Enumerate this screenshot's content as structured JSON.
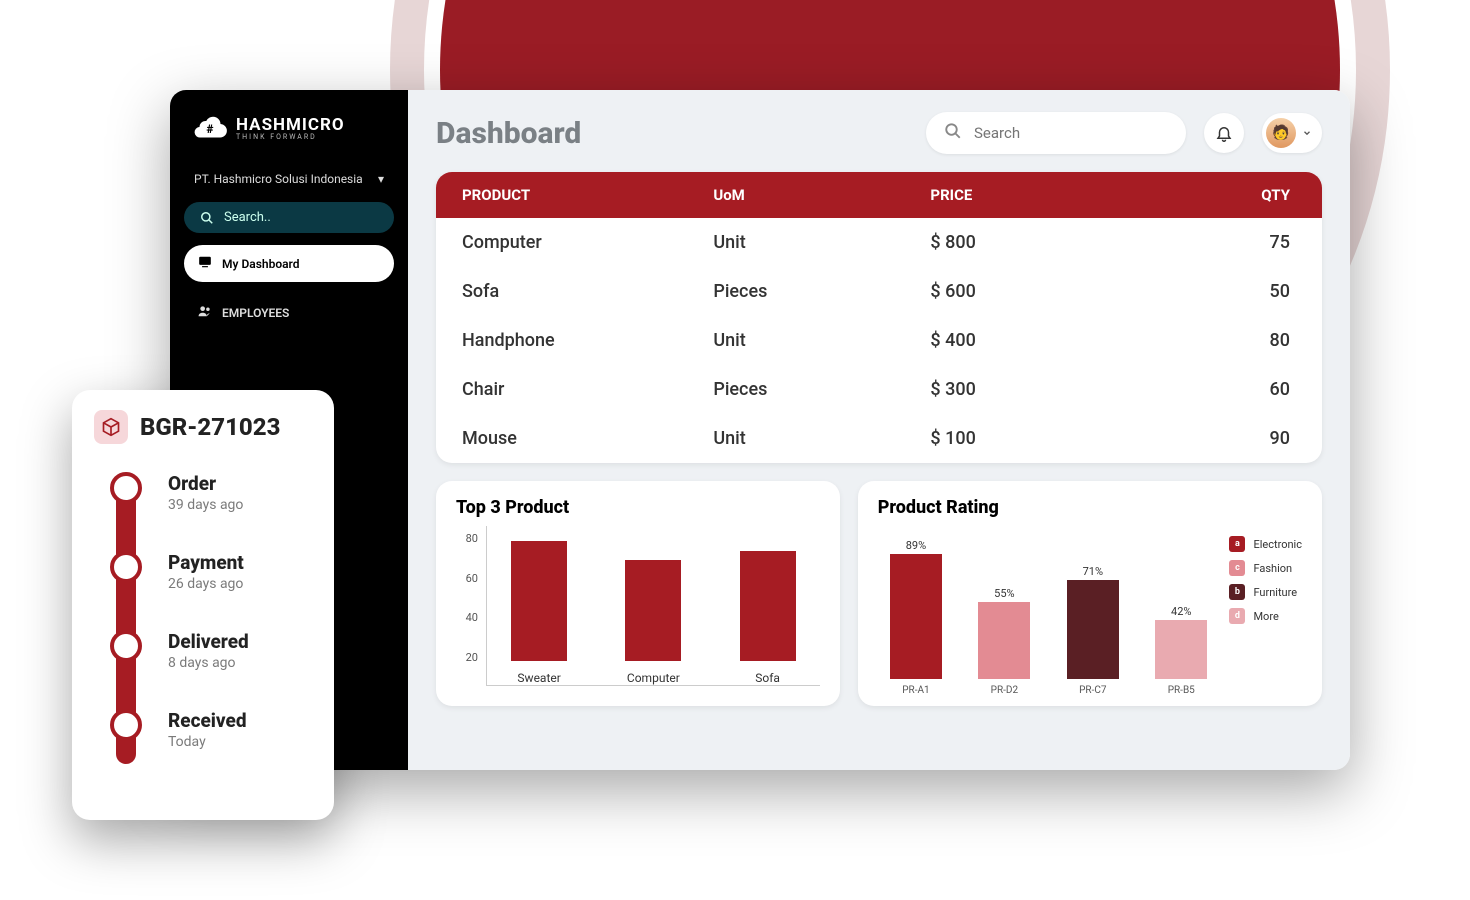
{
  "brand": {
    "name": "HASHMICRO",
    "tagline": "THINK FORWARD"
  },
  "sidebar": {
    "org": "PT. Hashmicro Solusi Indonesia",
    "search_placeholder": "Search..",
    "nav": {
      "dashboard": "My Dashboard",
      "employees": "EMPLOYEES"
    }
  },
  "header": {
    "title": "Dashboard",
    "search_placeholder": "Search"
  },
  "table": {
    "headers": {
      "product": "PRODUCT",
      "uom": "UoM",
      "price": "PRICE",
      "qty": "QTY"
    },
    "rows": [
      {
        "product": "Computer",
        "uom": "Unit",
        "price": "$ 800",
        "qty": "75"
      },
      {
        "product": "Sofa",
        "uom": "Pieces",
        "price": "$ 600",
        "qty": "50"
      },
      {
        "product": "Handphone",
        "uom": "Unit",
        "price": "$ 400",
        "qty": "80"
      },
      {
        "product": "Chair",
        "uom": "Pieces",
        "price": "$ 300",
        "qty": "60"
      },
      {
        "product": "Mouse",
        "uom": "Unit",
        "price": "$ 100",
        "qty": "90"
      }
    ]
  },
  "top3_title": "Top 3 Product",
  "rating_title": "Product Rating",
  "legend": {
    "a": "Electronic",
    "c": "Fashion",
    "b": "Furniture",
    "d": "More"
  },
  "tracking": {
    "ref": "BGR-271023",
    "steps": [
      {
        "title": "Order",
        "sub": "39 days ago"
      },
      {
        "title": "Payment",
        "sub": "26 days ago"
      },
      {
        "title": "Delivered",
        "sub": "8 days ago"
      },
      {
        "title": "Received",
        "sub": "Today"
      }
    ]
  },
  "colors": {
    "brand_red": "#a61c23",
    "dark_red": "#5a1f24",
    "pink": "#e38b93",
    "light_pink": "#e9aab0"
  },
  "chart_data": [
    {
      "type": "bar",
      "title": "Top 3 Product",
      "categories": [
        "Sweater",
        "Computer",
        "Sofa"
      ],
      "values": [
        74,
        62,
        68
      ],
      "ylim": [
        0,
        80
      ],
      "yticks": [
        20,
        40,
        60,
        80
      ],
      "xlabel": "",
      "ylabel": ""
    },
    {
      "type": "bar",
      "title": "Product Rating",
      "categories": [
        "PR-A1",
        "PR-D2",
        "PR-C7",
        "PR-B5"
      ],
      "series": [
        {
          "name": "Electronic",
          "color": "#a61c23",
          "letter": "a"
        },
        {
          "name": "Fashion",
          "color": "#e38b93",
          "letter": "c"
        },
        {
          "name": "Furniture",
          "color": "#5a1f24",
          "letter": "b"
        },
        {
          "name": "More",
          "color": "#e9aab0",
          "letter": "d"
        }
      ],
      "values": [
        89,
        55,
        71,
        42
      ],
      "value_labels": [
        "89%",
        "55%",
        "71%",
        "42%"
      ],
      "ylim": [
        0,
        100
      ],
      "xlabel": "",
      "ylabel": ""
    }
  ]
}
